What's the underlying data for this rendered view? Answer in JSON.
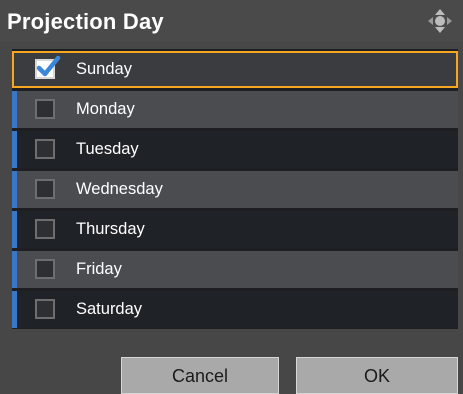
{
  "dialog": {
    "title": "Projection Day",
    "move_icon": "move-arrows-icon"
  },
  "days": [
    {
      "label": "Sunday",
      "checked": true,
      "selected": true
    },
    {
      "label": "Monday",
      "checked": false,
      "selected": false
    },
    {
      "label": "Tuesday",
      "checked": false,
      "selected": false
    },
    {
      "label": "Wednesday",
      "checked": false,
      "selected": false
    },
    {
      "label": "Thursday",
      "checked": false,
      "selected": false
    },
    {
      "label": "Friday",
      "checked": false,
      "selected": false
    },
    {
      "label": "Saturday",
      "checked": false,
      "selected": false
    }
  ],
  "buttons": {
    "cancel_label": "Cancel",
    "ok_label": "OK"
  },
  "colors": {
    "focus": "#f6a623",
    "stripe": "#3a78c7",
    "check": "#3a86d8"
  }
}
